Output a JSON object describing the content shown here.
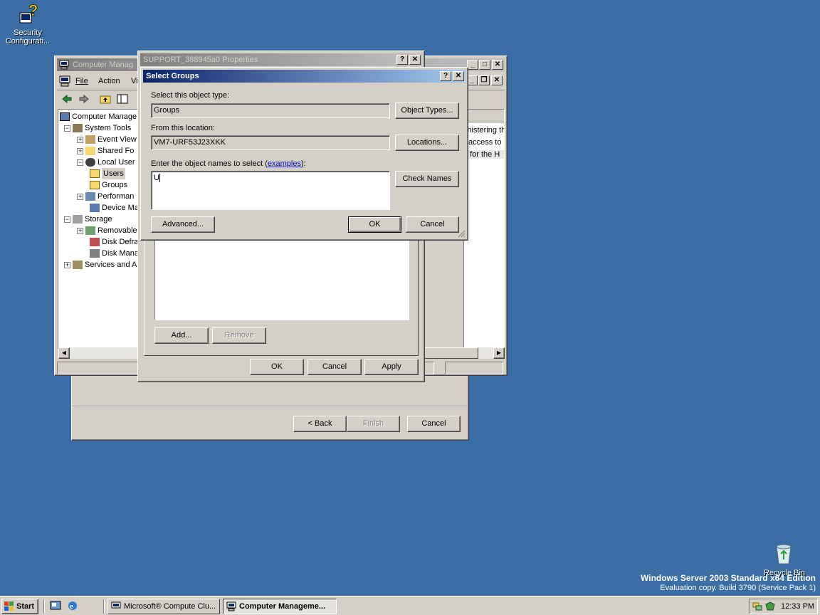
{
  "desktop": {
    "security_icon_label_1": "Security",
    "security_icon_label_2": "Configurati...",
    "recycle_bin_label": "Recycle Bin",
    "watermark_line1": "Windows Server 2003 Standard x64 Edition",
    "watermark_line2": "Evaluation copy. Build 3790 (Service Pack 1)"
  },
  "computer_management": {
    "title": "Computer Manag",
    "menu": {
      "file": "File",
      "action": "Action",
      "view": "Vi"
    },
    "tree": [
      {
        "label": "Computer Manage"
      },
      {
        "label": "System Tools"
      },
      {
        "label": "Event View"
      },
      {
        "label": "Shared Fo"
      },
      {
        "label": "Local User"
      },
      {
        "label": "Users"
      },
      {
        "label": "Groups"
      },
      {
        "label": "Performan"
      },
      {
        "label": "Device Ma"
      },
      {
        "label": "Storage"
      },
      {
        "label": "Removable"
      },
      {
        "label": "Disk Defra"
      },
      {
        "label": "Disk Manag"
      },
      {
        "label": "Services and A"
      }
    ],
    "right_text": [
      "inistering th",
      "access to",
      "t for the H"
    ]
  },
  "wizard": {
    "back_label": "< Back",
    "finish_label": "Finish",
    "cancel_label": "Cancel"
  },
  "properties": {
    "title": "SUPPORT_388945a0 Properties",
    "add_label": "Add...",
    "remove_label": "Remove",
    "ok_label": "OK",
    "cancel_label": "Cancel",
    "apply_label": "Apply"
  },
  "select_groups": {
    "title": "Select Groups",
    "object_type_label": "Select this object type:",
    "object_type_value": "Groups",
    "object_types_button": "Object Types...",
    "location_label": "From this location:",
    "location_value": "VM7-URF53J23XKK",
    "locations_button": "Locations...",
    "names_label": "Enter the object names to select (",
    "examples_link": "examples",
    "names_label_end": "):",
    "names_value": "U",
    "check_names_button": "Check Names",
    "advanced_button": "Advanced...",
    "ok_button": "OK",
    "cancel_button": "Cancel"
  },
  "taskbar": {
    "start_label": "Start",
    "task1": "Microsoft® Compute Clu...",
    "task2": "Computer Manageme...",
    "clock": "12:33 PM"
  },
  "colors": {
    "desktop": "#3a6ea5",
    "active_title": "#0a246a",
    "face": "#d4d0c8"
  }
}
